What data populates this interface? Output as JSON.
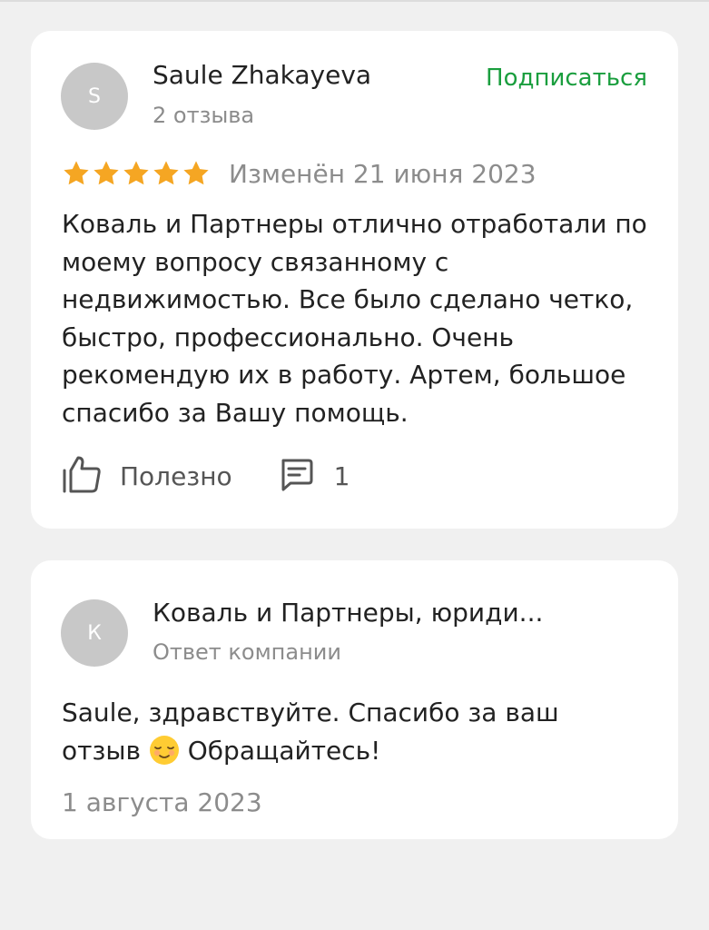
{
  "review": {
    "author": {
      "initial": "S",
      "name": "Saule Zhakayeva",
      "reviews_count": "2 отзыва"
    },
    "subscribe_label": "Подписаться",
    "rating": 5,
    "rating_max": 5,
    "edited_date": "Изменён 21 июня 2023",
    "text": "Коваль и Партнеры отлично отработали по моему вопросу связанному с недвижимостью. Все было сделано четко, быстро, профессионально. Очень рекомендую их в работу. Артем, большое спасибо за Вашу помощь.",
    "helpful_label": "Полезно",
    "comments_count": "1"
  },
  "reply": {
    "author": {
      "initial": "К",
      "name": "Коваль и Партнеры, юриди...",
      "role": "Ответ компании"
    },
    "text_before_emoji": "Saule, здравствуйте. Спасибо за ваш отзыв ",
    "emoji": "relieved-face",
    "text_after_emoji": " Обращайтесь!",
    "date": "1 августа 2023"
  },
  "colors": {
    "background": "#f0f0f0",
    "card": "#ffffff",
    "accent_green": "#1a9e3e",
    "star": "#f5a623",
    "muted_text": "#8c8c8c",
    "avatar": "#c8c8c8"
  },
  "icons": [
    "star-icon",
    "thumbs-up-icon",
    "comment-icon",
    "relieved-face-emoji"
  ]
}
